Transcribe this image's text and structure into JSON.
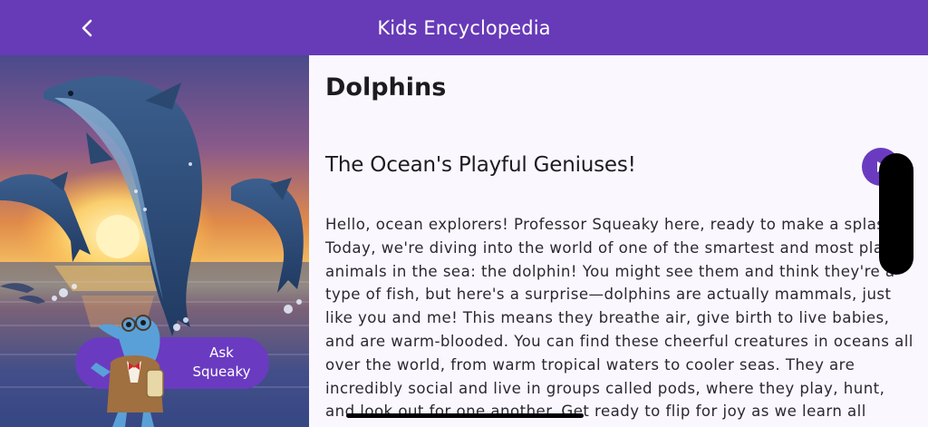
{
  "header": {
    "title": "Kids Encyclopedia",
    "back_icon": "chevron-left-icon"
  },
  "hero": {
    "image_subject": "dolphins leaping at sunset",
    "ask_button_label": "Ask\nSqueaky",
    "mascot_icon": "professor-squeaky-dolphin-icon"
  },
  "article": {
    "title": "Dolphins",
    "section_heading": "The Ocean's Playful Geniuses!",
    "play_icon": "play-icon",
    "body": "Hello, ocean explorers! Professor Squeaky here, ready to make a splash! Today, we're diving into the world of one of the smartest and most playful animals in the sea: the dolphin! You might see them and think they're a type of fish, but here's a surprise—dolphins are actually mammals, just like you and me! This means they breathe air, give birth to live babies, and are warm-blooded. You can find these cheerful creatures in oceans all over the world, from warm tropical waters to cooler seas. They are incredibly social and live in groups called pods, where they play, hunt, and look out for one another. Get ready to flip for joy as we learn all about these amazing"
  },
  "colors": {
    "header": "#673ab7",
    "accent": "#6a3bc0",
    "content_bg": "#fbf7fe",
    "text": "#1c1b1f"
  }
}
